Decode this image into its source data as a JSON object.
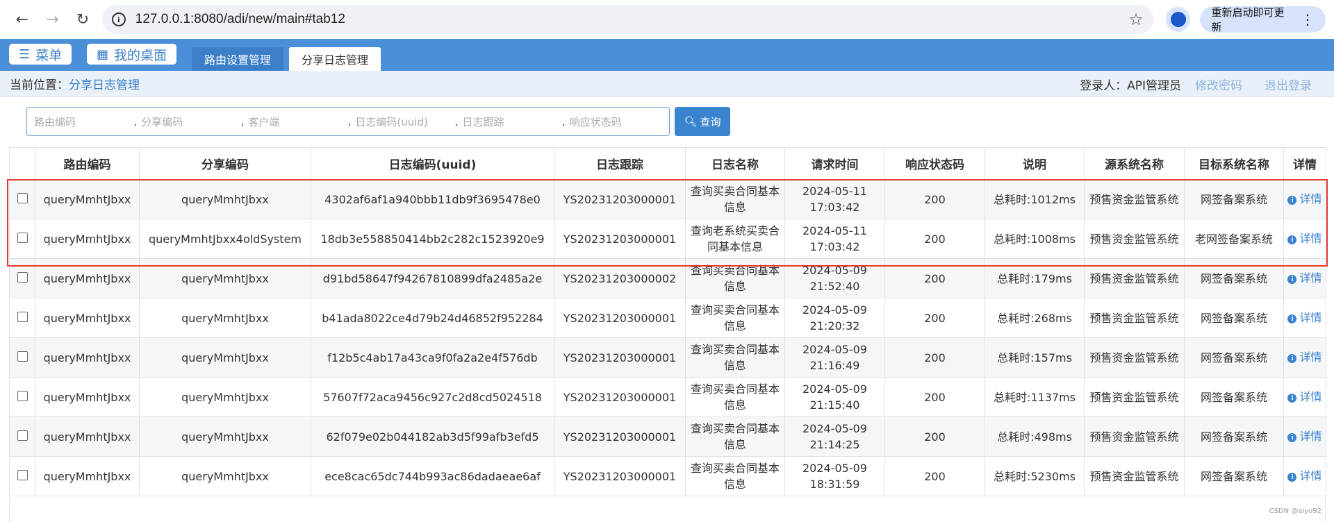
{
  "browser": {
    "url": "127.0.0.1:8080/adi/new/main#tab12",
    "update_label": "重新启动即可更新"
  },
  "header": {
    "menu_label": "菜单",
    "desktop_label": "我的桌面",
    "tabs": [
      {
        "label": "路由设置管理",
        "active": false
      },
      {
        "label": "分享日志管理",
        "active": true
      }
    ]
  },
  "breadcrumb": {
    "label": "当前位置：",
    "current": "分享日志管理",
    "user": "登录人：API管理员",
    "change_password": "修改密码",
    "logout": "退出登录"
  },
  "search": {
    "placeholders": [
      "路由编码",
      "分享编码",
      "客户端",
      "日志编码(uuid)",
      "日志跟踪",
      "响应状态码"
    ],
    "separator": ",",
    "button_label": "查询"
  },
  "table": {
    "columns": [
      "",
      "路由编码",
      "分享编码",
      "日志编码(uuid)",
      "日志跟踪",
      "日志名称",
      "请求时间",
      "响应状态码",
      "说明",
      "源系统名称",
      "目标系统名称",
      "详情"
    ],
    "detail_label": "详情",
    "rows": [
      {
        "route": "queryMmhtJbxx",
        "share": "queryMmhtJbxx",
        "uuid": "4302af6af1a940bbb11db9f3695478e0",
        "trace": "YS20231203000001",
        "name": "查询买卖合同基本信息",
        "date": "2024-05-11",
        "time": "17:03:42",
        "status": "200",
        "desc": "总耗时:1012ms",
        "source": "预售资金监管系统",
        "target": "网签备案系统"
      },
      {
        "route": "queryMmhtJbxx",
        "share": "queryMmhtJbxx4oldSystem",
        "uuid": "18db3e558850414bb2c282c1523920e9",
        "trace": "YS20231203000001",
        "name": "查询老系统买卖合同基本信息",
        "date": "2024-05-11",
        "time": "17:03:42",
        "status": "200",
        "desc": "总耗时:1008ms",
        "source": "预售资金监管系统",
        "target": "老网签备案系统"
      },
      {
        "route": "queryMmhtJbxx",
        "share": "queryMmhtJbxx",
        "uuid": "d91bd58647f94267810899dfa2485a2e",
        "trace": "YS20231203000002",
        "name": "查询买卖合同基本信息",
        "date": "2024-05-09",
        "time": "21:52:40",
        "status": "200",
        "desc": "总耗时:179ms",
        "source": "预售资金监管系统",
        "target": "网签备案系统"
      },
      {
        "route": "queryMmhtJbxx",
        "share": "queryMmhtJbxx",
        "uuid": "b41ada8022ce4d79b24d46852f952284",
        "trace": "YS20231203000001",
        "name": "查询买卖合同基本信息",
        "date": "2024-05-09",
        "time": "21:20:32",
        "status": "200",
        "desc": "总耗时:268ms",
        "source": "预售资金监管系统",
        "target": "网签备案系统"
      },
      {
        "route": "queryMmhtJbxx",
        "share": "queryMmhtJbxx",
        "uuid": "f12b5c4ab17a43ca9f0fa2a2e4f576db",
        "trace": "YS20231203000001",
        "name": "查询买卖合同基本信息",
        "date": "2024-05-09",
        "time": "21:16:49",
        "status": "200",
        "desc": "总耗时:157ms",
        "source": "预售资金监管系统",
        "target": "网签备案系统"
      },
      {
        "route": "queryMmhtJbxx",
        "share": "queryMmhtJbxx",
        "uuid": "57607f72aca9456c927c2d8cd5024518",
        "trace": "YS20231203000001",
        "name": "查询买卖合同基本信息",
        "date": "2024-05-09",
        "time": "21:15:40",
        "status": "200",
        "desc": "总耗时:1137ms",
        "source": "预售资金监管系统",
        "target": "网签备案系统"
      },
      {
        "route": "queryMmhtJbxx",
        "share": "queryMmhtJbxx",
        "uuid": "62f079e02b044182ab3d5f99afb3efd5",
        "trace": "YS20231203000001",
        "name": "查询买卖合同基本信息",
        "date": "2024-05-09",
        "time": "21:14:25",
        "status": "200",
        "desc": "总耗时:498ms",
        "source": "预售资金监管系统",
        "target": "网签备案系统"
      },
      {
        "route": "queryMmhtJbxx",
        "share": "queryMmhtJbxx",
        "uuid": "ece8cac65dc744b993ac86dadaeae6af",
        "trace": "YS20231203000001",
        "name": "查询买卖合同基本信息",
        "date": "2024-05-09",
        "time": "18:31:59",
        "status": "200",
        "desc": "总耗时:5230ms",
        "source": "预售资金监管系统",
        "target": "网签备案系统"
      }
    ]
  },
  "watermark": "CSDN @aiyo92"
}
